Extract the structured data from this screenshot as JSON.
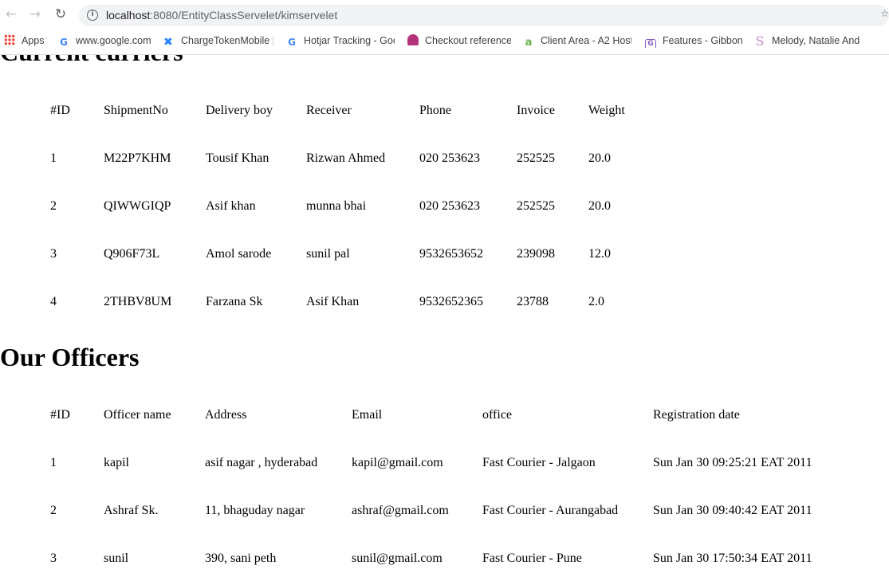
{
  "browser": {
    "url_host": "localhost",
    "url_rest": ":8080/EntityClassServelet/kimservelet",
    "bookmarks": [
      {
        "label": "Apps",
        "icon": "apps-grid-icon"
      },
      {
        "label": "www.google.com",
        "icon": "google-icon"
      },
      {
        "label": "ChargeTokenMobile |",
        "icon": "confluence-icon"
      },
      {
        "label": "Hotjar Tracking - Goo",
        "icon": "google-icon"
      },
      {
        "label": "Checkout reference",
        "icon": "octopus-icon"
      },
      {
        "label": "Client Area - A2 Host",
        "icon": "a2-icon"
      },
      {
        "label": "Features - Gibbon",
        "icon": "gibbon-icon"
      },
      {
        "label": "Melody, Natalie And",
        "icon": "s-icon"
      }
    ]
  },
  "couriers": {
    "title": "Current curriers",
    "headers": [
      "#ID",
      "ShipmentNo",
      "Delivery boy",
      "Receiver",
      "Phone",
      "Invoice",
      "Weight"
    ],
    "rows": [
      [
        "1",
        "M22P7KHM",
        "Tousif Khan",
        "Rizwan Ahmed",
        "020 253623",
        "252525",
        "20.0"
      ],
      [
        "2",
        "QIWWGIQP",
        "Asif khan",
        "munna bhai",
        "020 253623",
        "252525",
        "20.0"
      ],
      [
        "3",
        "Q906F73L",
        "Amol sarode",
        "sunil pal",
        "9532653652",
        "239098",
        "12.0"
      ],
      [
        "4",
        "2THBV8UM",
        "Farzana Sk",
        "Asif Khan",
        "9532652365",
        "23788",
        "2.0"
      ]
    ]
  },
  "officers": {
    "title": "Our Officers",
    "headers": [
      "#ID",
      "Officer name",
      "Address",
      "Email",
      "office",
      "Registration date"
    ],
    "rows": [
      [
        "1",
        "kapil",
        "asif nagar , hyderabad",
        "kapil@gmail.com",
        "Fast Courier - Jalgaon",
        "Sun Jan 30 09:25:21 EAT 2011"
      ],
      [
        "2",
        "Ashraf Sk.",
        "11, bhaguday nagar",
        "ashraf@gmail.com",
        "Fast Courier - Aurangabad",
        "Sun Jan 30 09:40:42 EAT 2011"
      ],
      [
        "3",
        "sunil",
        "390, sani peth",
        "sunil@gmail.com",
        "Fast Courier - Pune",
        "Sun Jan 30 17:50:34 EAT 2011"
      ]
    ]
  }
}
